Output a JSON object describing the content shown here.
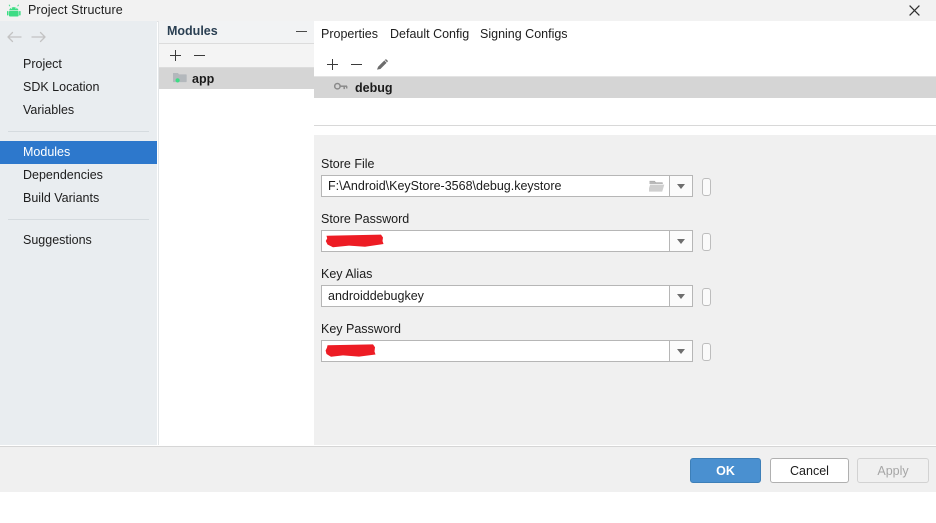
{
  "window": {
    "title": "Project Structure",
    "app_icon": "android-robot-icon",
    "close_label": "✕"
  },
  "nav": {
    "back_icon": "arrow-left-icon",
    "forward_icon": "arrow-right-icon",
    "items": [
      {
        "label": "Project",
        "selected": false
      },
      {
        "label": "SDK Location",
        "selected": false
      },
      {
        "label": "Variables",
        "selected": false
      },
      {
        "label": "Modules",
        "selected": true
      },
      {
        "label": "Dependencies",
        "selected": false
      },
      {
        "label": "Build Variants",
        "selected": false
      },
      {
        "label": "Suggestions",
        "selected": false
      }
    ]
  },
  "modules_panel": {
    "title": "Modules",
    "minimize_icon": "minimize-icon",
    "add_label": "+",
    "remove_label": "−",
    "items": [
      {
        "label": "app",
        "icon": "module-folder-icon",
        "selected": true
      }
    ]
  },
  "tabs": [
    {
      "label": "Properties",
      "active": false
    },
    {
      "label": "Default Config",
      "active": false
    },
    {
      "label": "Signing Configs",
      "active": true
    }
  ],
  "configs_toolbar": {
    "add_label": "+",
    "remove_label": "−",
    "edit_icon": "pencil-icon"
  },
  "configs_list": [
    {
      "label": "debug",
      "icon": "key-icon",
      "selected": true
    }
  ],
  "fields": [
    {
      "label": "Store File",
      "value": "F:\\Android\\KeyStore-3568\\debug.keystore",
      "redacted": false,
      "has_folder_button": true,
      "folder_icon": "folder-browse-icon",
      "dropdown_icon": "chevron-down-icon",
      "variable_chip_icon": "variable-selector-icon"
    },
    {
      "label": "Store Password",
      "value": "",
      "redacted": true,
      "has_folder_button": false,
      "dropdown_icon": "chevron-down-icon",
      "variable_chip_icon": "variable-selector-icon"
    },
    {
      "label": "Key Alias",
      "value": "androiddebugkey",
      "redacted": false,
      "has_folder_button": false,
      "dropdown_icon": "chevron-down-icon",
      "variable_chip_icon": "variable-selector-icon"
    },
    {
      "label": "Key Password",
      "value": "",
      "redacted": true,
      "has_folder_button": false,
      "dropdown_icon": "chevron-down-icon",
      "variable_chip_icon": "variable-selector-icon"
    }
  ],
  "buttons": {
    "ok": "OK",
    "cancel": "Cancel",
    "apply": "Apply",
    "apply_disabled": true
  },
  "colors": {
    "accent": "#2d78cc",
    "tab_underline": "#3a7fc1",
    "ok_button": "#4a90d0",
    "sidebar_bg": "#e9edf0",
    "form_bg": "#f0f0f0",
    "redaction": "#ed1c24",
    "android_green": "#3ddc84"
  }
}
